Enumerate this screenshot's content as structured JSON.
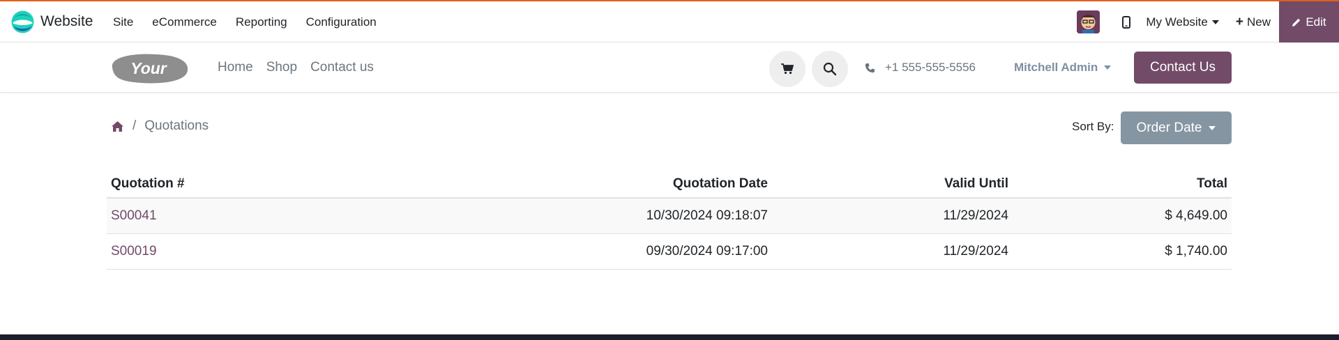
{
  "admin_bar": {
    "app_name": "Website",
    "menu": [
      "Site",
      "eCommerce",
      "Reporting",
      "Configuration"
    ],
    "website_selector": "My Website",
    "new_label": "New",
    "edit_label": "Edit",
    "accent_color": "#714b67",
    "top_border_color": "#e0601c"
  },
  "site_header": {
    "nav": [
      "Home",
      "Shop",
      "Contact us"
    ],
    "phone": "+1 555-555-5556",
    "user_name": "Mitchell Admin",
    "contact_button": "Contact Us",
    "icons": [
      "cart-icon",
      "search-icon",
      "phone-icon"
    ]
  },
  "breadcrumb": {
    "current": "Quotations"
  },
  "sort": {
    "label": "Sort By:",
    "value": "Order Date"
  },
  "table": {
    "headers": [
      "Quotation #",
      "Quotation Date",
      "Valid Until",
      "Total"
    ],
    "rows": [
      {
        "number": "S00041",
        "date": "10/30/2024 09:18:07",
        "valid_until": "11/29/2024",
        "total": "$ 4,649.00"
      },
      {
        "number": "S00019",
        "date": "09/30/2024 09:17:00",
        "valid_until": "11/29/2024",
        "total": "$ 1,740.00"
      }
    ]
  }
}
